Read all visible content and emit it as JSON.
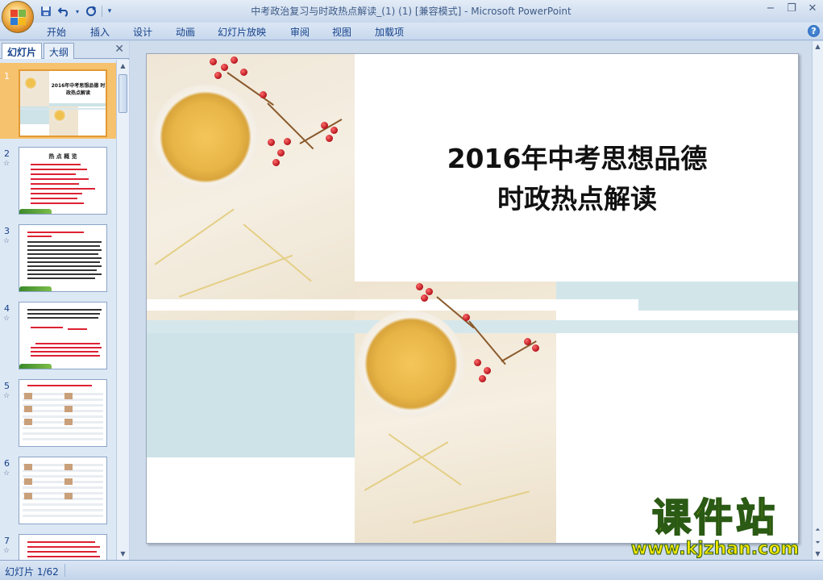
{
  "window": {
    "title": "中考政治复习与时政热点解读_(1) (1) [兼容模式] - Microsoft PowerPoint",
    "minimize": "−",
    "restore": "❐",
    "close": "✕"
  },
  "quick_access": {
    "save_icon": "save-icon",
    "undo_icon": "undo-icon",
    "redo_icon": "redo-icon"
  },
  "ribbon": {
    "tabs": [
      "开始",
      "插入",
      "设计",
      "动画",
      "幻灯片放映",
      "审阅",
      "视图",
      "加载项"
    ],
    "help": "?"
  },
  "panel": {
    "tab_slides": "幻灯片",
    "tab_outline": "大纲",
    "close": "✕"
  },
  "thumbnails": [
    {
      "num": "1",
      "title": "2016年中考思想品德 时政热点解读",
      "active": true
    },
    {
      "num": "2",
      "title": "热 点 概 览",
      "anim": "☆"
    },
    {
      "num": "3",
      "anim": "☆"
    },
    {
      "num": "4",
      "anim": "☆"
    },
    {
      "num": "5",
      "anim": "☆"
    },
    {
      "num": "6",
      "anim": "☆"
    },
    {
      "num": "7",
      "anim": "☆"
    }
  ],
  "slide": {
    "title_line1": "2016年中考思想品德",
    "title_line2": "时政热点解读"
  },
  "watermark": {
    "text_cn": "课件站",
    "url": "www.kjzhan.com"
  },
  "status": {
    "slide_counter": "幻灯片 1/62"
  },
  "colors": {
    "accent": "#15428b",
    "active_thumb": "#f6c26e",
    "watermark_fill": "#f2e600"
  }
}
